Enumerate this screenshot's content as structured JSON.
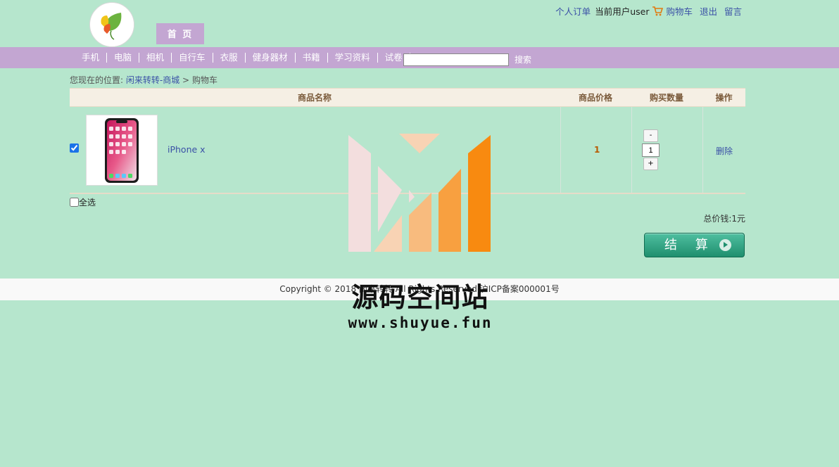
{
  "header": {
    "home_tab": "首 页",
    "orders_link": "个人订单",
    "current_user": "当前用户user",
    "cart_link": "购物车",
    "logout_link": "退出",
    "message_link": "留言"
  },
  "nav": {
    "items": [
      "手机",
      "电脑",
      "相机",
      "自行车",
      "衣服",
      "健身器材",
      "书籍",
      "学习资料",
      "试卷"
    ],
    "search_value": "",
    "search_button": "搜索"
  },
  "breadcrumb": {
    "prefix": "您现在的位置:",
    "link": "闲来转转-商城",
    "separator": ">",
    "current": "购物车"
  },
  "table": {
    "headers": {
      "name": "商品名称",
      "price": "商品价格",
      "qty": "购买数量",
      "action": "操作"
    },
    "rows": [
      {
        "checked": true,
        "name": "iPhone x",
        "price": "1",
        "qty": "1",
        "minus": "-",
        "plus": "+",
        "delete": "删除"
      }
    ]
  },
  "select_all": "全选",
  "total": "总价钱:1元",
  "checkout": "结 算",
  "footer": "Copyright © 2018 闲来转转 All Rights Reserved 沪ICP备案000001号",
  "watermark": {
    "title": "源码空间站",
    "url": "www.shuyue.fun"
  },
  "colors": {
    "background": "#b6e6cd",
    "nav_bar": "#c3a6d2",
    "link": "#3a50a6",
    "price": "#b85a00",
    "checkout": "#1f8f6e"
  }
}
